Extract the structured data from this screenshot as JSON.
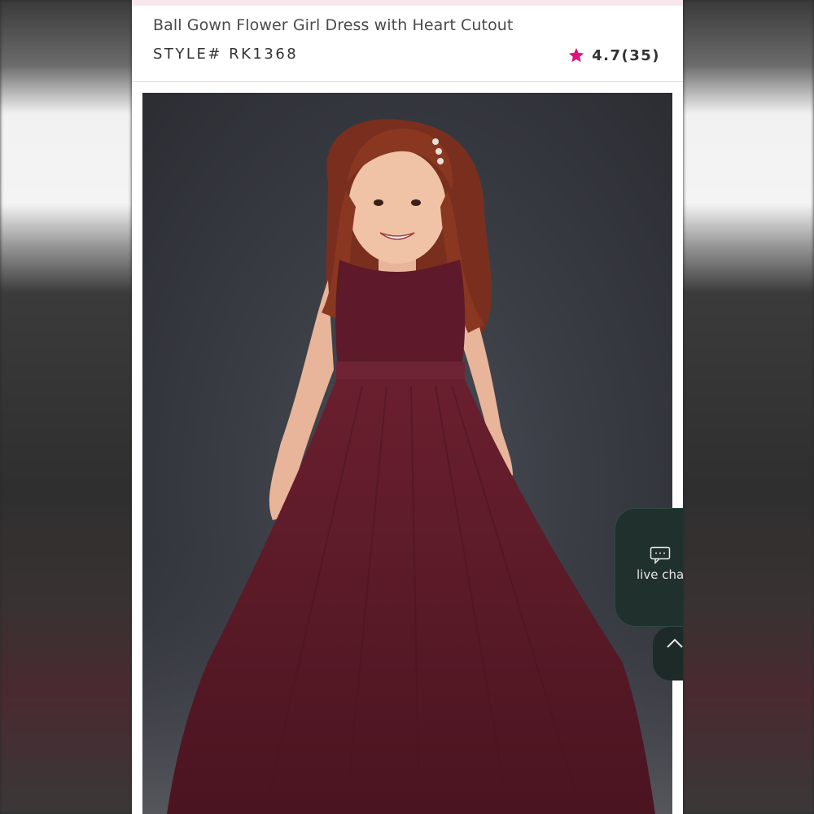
{
  "product": {
    "title": "Ball Gown Flower Girl Dress with Heart Cutout",
    "style": "STYLE# RK1368",
    "rating": "4.7(35)"
  },
  "image": {
    "alt": "Young girl wearing burgundy ball gown flower girl dress with lace bodice and tulle skirt"
  },
  "chat": {
    "label": "live chat"
  },
  "colors": {
    "star": "#e0127c",
    "dress": "#5a1a26",
    "chat_bg": "#20302d"
  }
}
